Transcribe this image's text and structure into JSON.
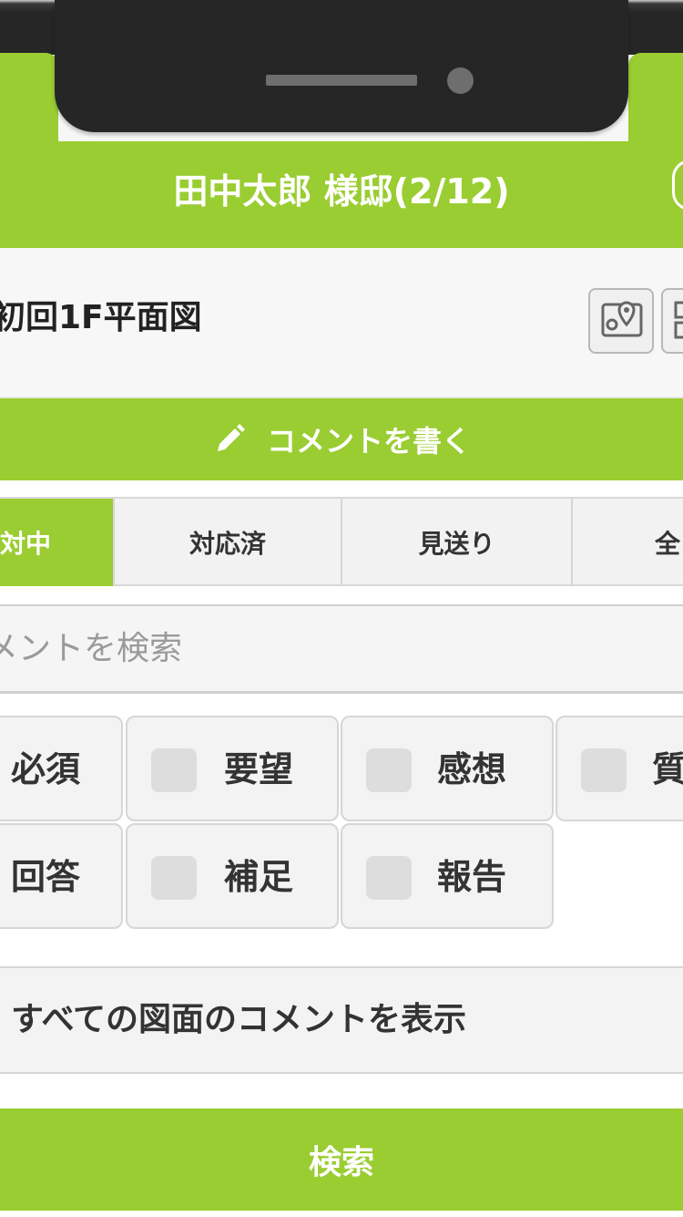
{
  "header": {
    "title": "田中太郎 様邸(2/12)"
  },
  "drawing": {
    "name": "初回1F平面図"
  },
  "actions": {
    "write_comment_label": "コメントを書く"
  },
  "tabs": [
    {
      "label": "対中",
      "active": true
    },
    {
      "label": "対応済",
      "active": false
    },
    {
      "label": "見送り",
      "active": false
    },
    {
      "label": "全",
      "active": false
    }
  ],
  "search": {
    "placeholder": "メントを検索"
  },
  "categories": [
    {
      "label": "必須"
    },
    {
      "label": "要望"
    },
    {
      "label": "感想"
    },
    {
      "label": "質"
    },
    {
      "label": "回答"
    },
    {
      "label": "補足"
    },
    {
      "label": "報告"
    }
  ],
  "all_drawings_label": "すべての図面のコメントを表示",
  "search_button_label": "検索",
  "colors": {
    "accent": "#9ACD32",
    "panel": "#f3f3f3",
    "border": "#d6d6d6"
  },
  "icons": {
    "write": "pencil-icon",
    "map": "map-pin-icon"
  }
}
